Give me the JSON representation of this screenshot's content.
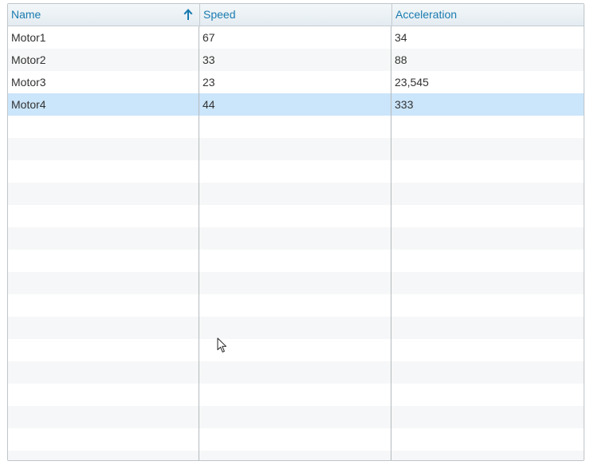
{
  "table": {
    "columns": [
      {
        "label": "Name"
      },
      {
        "label": "Speed"
      },
      {
        "label": "Acceleration"
      }
    ],
    "sort": {
      "column": "Name",
      "direction": "ascending",
      "icon": "arrow-up-icon"
    },
    "rows": [
      [
        "Motor1",
        "67",
        "34"
      ],
      [
        "Motor2",
        "33",
        "88"
      ],
      [
        "Motor3",
        "23",
        "23,545"
      ],
      [
        "Motor4",
        "44",
        "333"
      ]
    ],
    "selected_row": "Motor4",
    "colors": {
      "header_text": "#1a7bb0",
      "selection": "#cbe5fa",
      "stripe": "#f6f7f8"
    }
  },
  "cursor": {
    "icon": "mouse-pointer-icon"
  }
}
